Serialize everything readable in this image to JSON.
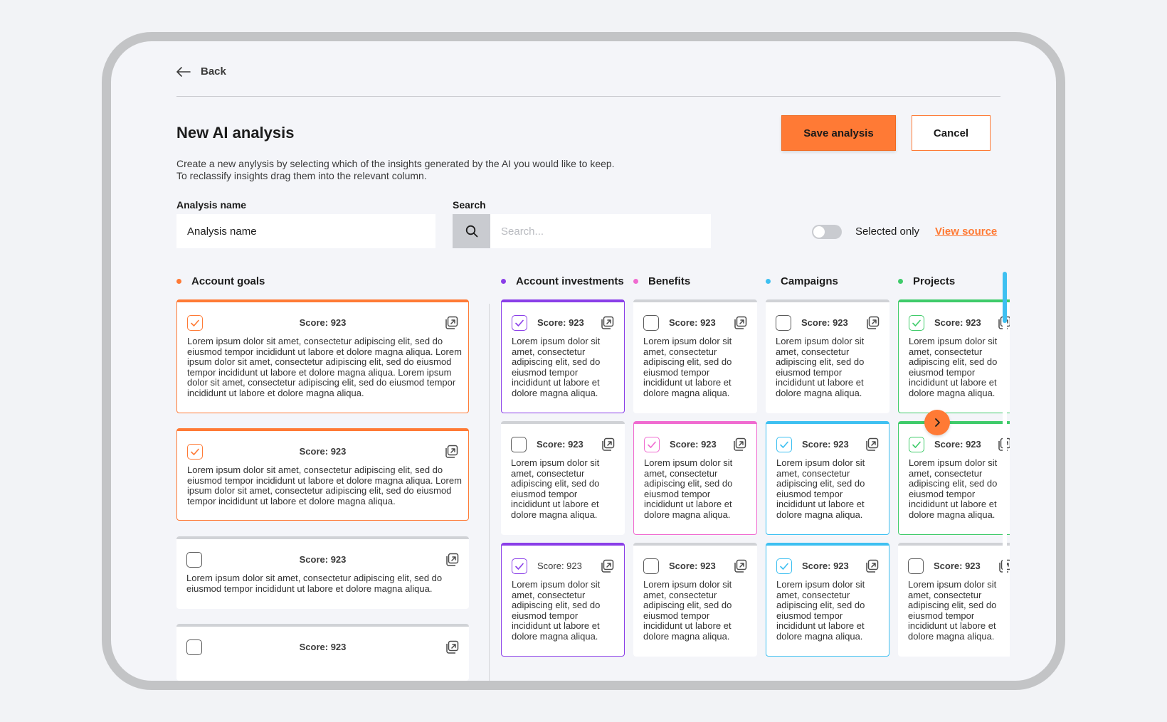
{
  "nav": {
    "back_label": "Back"
  },
  "header": {
    "title": "New AI analysis",
    "description_line1": "Create a new anylysis by selecting which of the insights generated by the AI you would like to keep.",
    "description_line2": "To reclassify insights drag them into the relevant column.",
    "save_label": "Save analysis",
    "cancel_label": "Cancel"
  },
  "form": {
    "name_label": "Analysis name",
    "name_value": "Analysis name",
    "search_label": "Search",
    "search_placeholder": "Search...",
    "toggle_label": "Selected only",
    "toggle_on": false,
    "view_source_label": "View source"
  },
  "colors": {
    "accent": "#ff7a35",
    "account_goals": "#ff7a35",
    "account_investments": "#8a3ee8",
    "benefits": "#f06bd0",
    "campaigns": "#3ec0f1",
    "projects": "#3fcb6a",
    "neutral": "#d0d2d6"
  },
  "columns": [
    {
      "id": "goals",
      "title": "Account goals",
      "color": "#ff7a35",
      "cards": [
        {
          "score": "Score: 923",
          "selected": true,
          "text": [
            "Lorem ipsum dolor sit amet, consectetur adipiscing elit, sed do",
            "eiusmod tempor incididunt ut labore et dolore magna aliqua. Lorem",
            "ipsum dolor sit amet, consectetur adipiscing elit, sed do eiusmod",
            "tempor incididunt ut labore et dolore magna aliqua. Lorem ipsum",
            "dolor sit amet, consectetur adipiscing elit, sed do eiusmod tempor",
            "incididunt ut labore et dolore magna aliqua."
          ]
        },
        {
          "score": "Score: 923",
          "selected": true,
          "text": [
            "Lorem ipsum dolor sit amet, consectetur adipiscing elit, sed do",
            "eiusmod tempor incididunt ut labore et dolore magna aliqua. Lorem",
            "ipsum dolor sit amet, consectetur adipiscing elit, sed do eiusmod",
            "tempor incididunt ut labore et dolore magna aliqua."
          ]
        },
        {
          "score": "Score: 923",
          "selected": false,
          "text": [
            "Lorem ipsum dolor sit amet, consectetur adipiscing elit, sed do",
            "eiusmod tempor incididunt ut labore et dolore magna aliqua."
          ]
        },
        {
          "score": "Score: 923",
          "selected": false,
          "text": []
        }
      ]
    },
    {
      "id": "investments",
      "title": "Account investments",
      "color": "#8a3ee8",
      "cards": [
        {
          "score": "Score: 923",
          "selected": true,
          "text": [
            "Lorem ipsum dolor sit",
            "amet, consectetur",
            "adipiscing elit, sed do",
            "eiusmod tempor",
            "incididunt ut labore et",
            "dolore magna aliqua."
          ]
        },
        {
          "score": "Score: 923",
          "selected": false,
          "text": [
            "Lorem ipsum dolor sit",
            "amet, consectetur",
            "adipiscing elit, sed do",
            "eiusmod tempor",
            "incididunt ut labore et",
            "dolore magna aliqua."
          ]
        },
        {
          "score": "Score: 923",
          "selected": true,
          "thin": true,
          "text": [
            "Lorem ipsum dolor sit",
            "amet, consectetur",
            "adipiscing elit, sed do",
            "eiusmod tempor",
            "incididunt ut labore et",
            "dolore magna aliqua."
          ]
        }
      ]
    },
    {
      "id": "benefits",
      "title": "Benefits",
      "color": "#f06bd0",
      "cards": [
        {
          "score": "Score: 923",
          "selected": false,
          "text": [
            "Lorem ipsum dolor sit",
            "amet, consectetur",
            "adipiscing elit, sed do",
            "eiusmod tempor",
            "incididunt ut labore et",
            "dolore magna aliqua."
          ]
        },
        {
          "score": "Score: 923",
          "selected": true,
          "text": [
            "Lorem ipsum dolor sit",
            "amet, consectetur",
            "adipiscing elit, sed do",
            "eiusmod tempor",
            "incididunt ut labore et",
            "dolore magna aliqua."
          ]
        },
        {
          "score": "Score: 923",
          "selected": false,
          "text": [
            "Lorem ipsum dolor sit",
            "amet, consectetur",
            "adipiscing elit, sed do",
            "eiusmod tempor",
            "incididunt ut labore et",
            "dolore magna aliqua."
          ]
        }
      ]
    },
    {
      "id": "campaigns",
      "title": "Campaigns",
      "color": "#3ec0f1",
      "cards": [
        {
          "score": "Score: 923",
          "selected": false,
          "text": [
            "Lorem ipsum dolor sit",
            "amet, consectetur",
            "adipiscing elit, sed do",
            "eiusmod tempor",
            "incididunt ut labore et",
            "dolore magna aliqua."
          ]
        },
        {
          "score": "Score: 923",
          "selected": true,
          "text": [
            "Lorem ipsum dolor sit",
            "amet, consectetur",
            "adipiscing elit, sed do",
            "eiusmod tempor",
            "incididunt ut labore et",
            "dolore magna aliqua."
          ]
        },
        {
          "score": "Score: 923",
          "selected": true,
          "text": [
            "Lorem ipsum dolor sit",
            "amet, consectetur",
            "adipiscing elit, sed do",
            "eiusmod tempor",
            "incididunt ut labore et",
            "dolore magna aliqua."
          ]
        }
      ]
    },
    {
      "id": "projects",
      "title": "Projects",
      "color": "#3fcb6a",
      "cards": [
        {
          "score": "Score: 923",
          "selected": true,
          "text": [
            "Lorem ipsum dolor sit",
            "amet, consectetur",
            "adipiscing elit, sed do",
            "eiusmod tempor",
            "incididunt ut labore et",
            "dolore magna aliqua."
          ]
        },
        {
          "score": "Score: 923",
          "selected": true,
          "text": [
            "Lorem ipsum dolor sit",
            "amet, consectetur",
            "adipiscing elit, sed do",
            "eiusmod tempor",
            "incididunt ut labore et",
            "dolore magna aliqua."
          ]
        },
        {
          "score": "Score: 923",
          "selected": false,
          "text": [
            "Lorem ipsum dolor sit",
            "amet, consectetur",
            "adipiscing elit, sed do",
            "eiusmod tempor",
            "incididunt ut labore et",
            "dolore magna aliqua."
          ]
        }
      ]
    }
  ],
  "icons": {
    "back": "arrow-left-icon",
    "search": "search-icon",
    "open": "open-external-icon",
    "check": "check-icon",
    "next": "chevron-right-icon"
  }
}
